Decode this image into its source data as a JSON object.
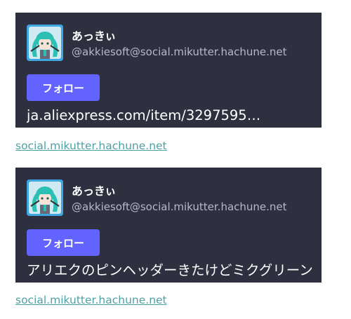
{
  "embeds": [
    {
      "display_name": "あっきぃ",
      "account": "@akkiesoft@social.mikutter.hachune.net",
      "follow_label": "フォロー",
      "text": "ja.aliexpress.com/item/3297595…",
      "link": "social.mikutter.hachune.net"
    },
    {
      "display_name": "あっきぃ",
      "account": "@akkiesoft@social.mikutter.hachune.net",
      "follow_label": "フォロー",
      "text": "アリエクのピンヘッダーきたけどミクグリーンじゃなかった",
      "link": "social.mikutter.hachune.net"
    }
  ],
  "colors": {
    "card_background": "#2e2f3f",
    "follow_button": "#6364ff",
    "link": "#4fa0a4",
    "account_text": "#b7b9cb"
  }
}
